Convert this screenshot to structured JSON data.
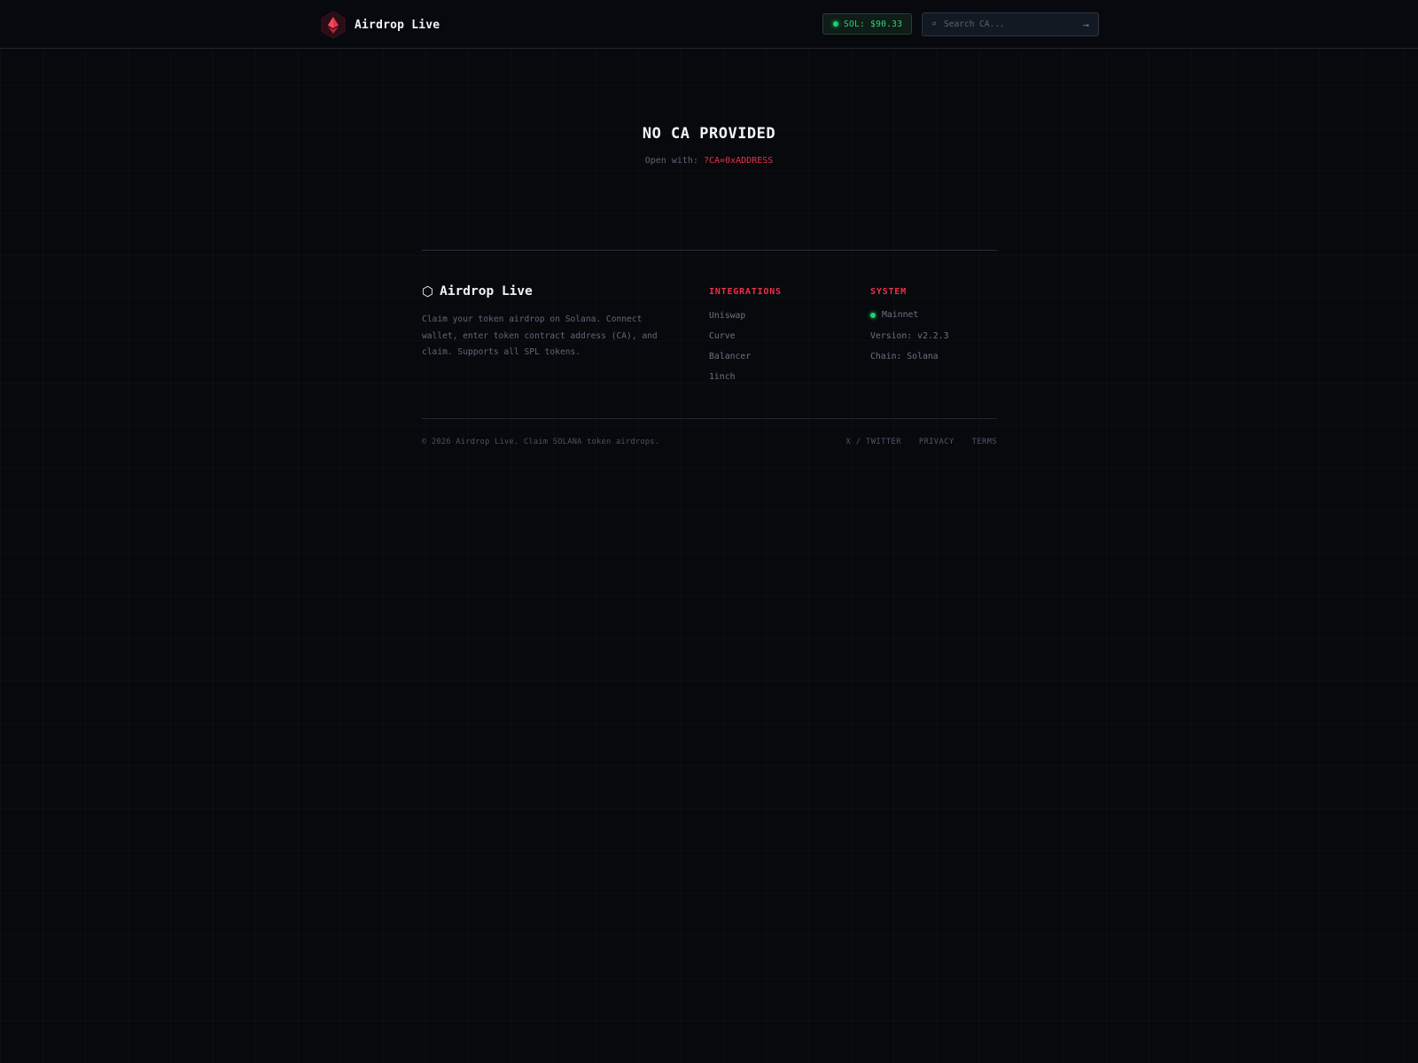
{
  "header": {
    "brand_name": "Airdrop Live",
    "sol_price": "SOL: $90.33",
    "search_placeholder": "Search CA...",
    "search_submit_glyph": "→",
    "search_icon_glyph": "⌕"
  },
  "notice": {
    "title": "NO CA PROVIDED",
    "prefix": "Open with:",
    "code": "?CA=0xADDRESS"
  },
  "footer": {
    "brand_name": "Airdrop Live",
    "brand_icon_glyph": "⬡",
    "description": "Claim your token airdrop on Solana. Connect wallet, enter token contract address (CA), and claim. Supports all SPL tokens.",
    "integrations": {
      "heading": "INTEGRATIONS",
      "items": [
        "Uniswap",
        "Curve",
        "Balancer",
        "1inch"
      ]
    },
    "system": {
      "heading": "SYSTEM",
      "network": "Mainnet",
      "version": "Version: v2.2.3",
      "chain": "Chain: Solana"
    },
    "copyright": "© 2026 Airdrop Live. Claim SOLANA token airdrops.",
    "links": [
      "X / TWITTER",
      "PRIVACY",
      "TERMS"
    ]
  },
  "colors": {
    "background": "#07090d",
    "accent_red": "#ee3048",
    "status_green": "#1fd16c",
    "text_primary": "#f1f3f7",
    "text_muted": "#6a7384"
  }
}
